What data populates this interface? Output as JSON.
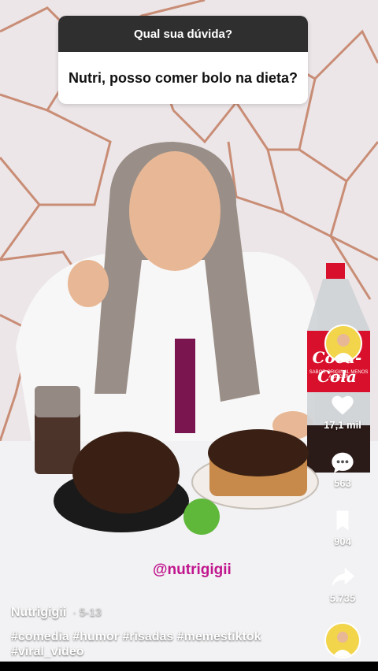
{
  "question": {
    "header": "Qual sua dúvida?",
    "text": "Nutri, posso comer bolo na dieta?"
  },
  "watermark": "@nutrigigii",
  "bottle_label": {
    "brand": "Coca-Cola",
    "sub": "SABOR ORIGINAL MENOS AÇÚCAR"
  },
  "actions": {
    "like_count": "17,1 mil",
    "comment_count": "563",
    "save_count": "904",
    "share_count": "5.735"
  },
  "caption": {
    "author": "Nutrigigii",
    "date": "5-13",
    "hashtags_line1": "#comedia #humor #risadas #memestiktok",
    "hashtags_line2": "#viral_video"
  },
  "colors": {
    "accent": "#c0168d",
    "coke_red": "#d8102b"
  }
}
